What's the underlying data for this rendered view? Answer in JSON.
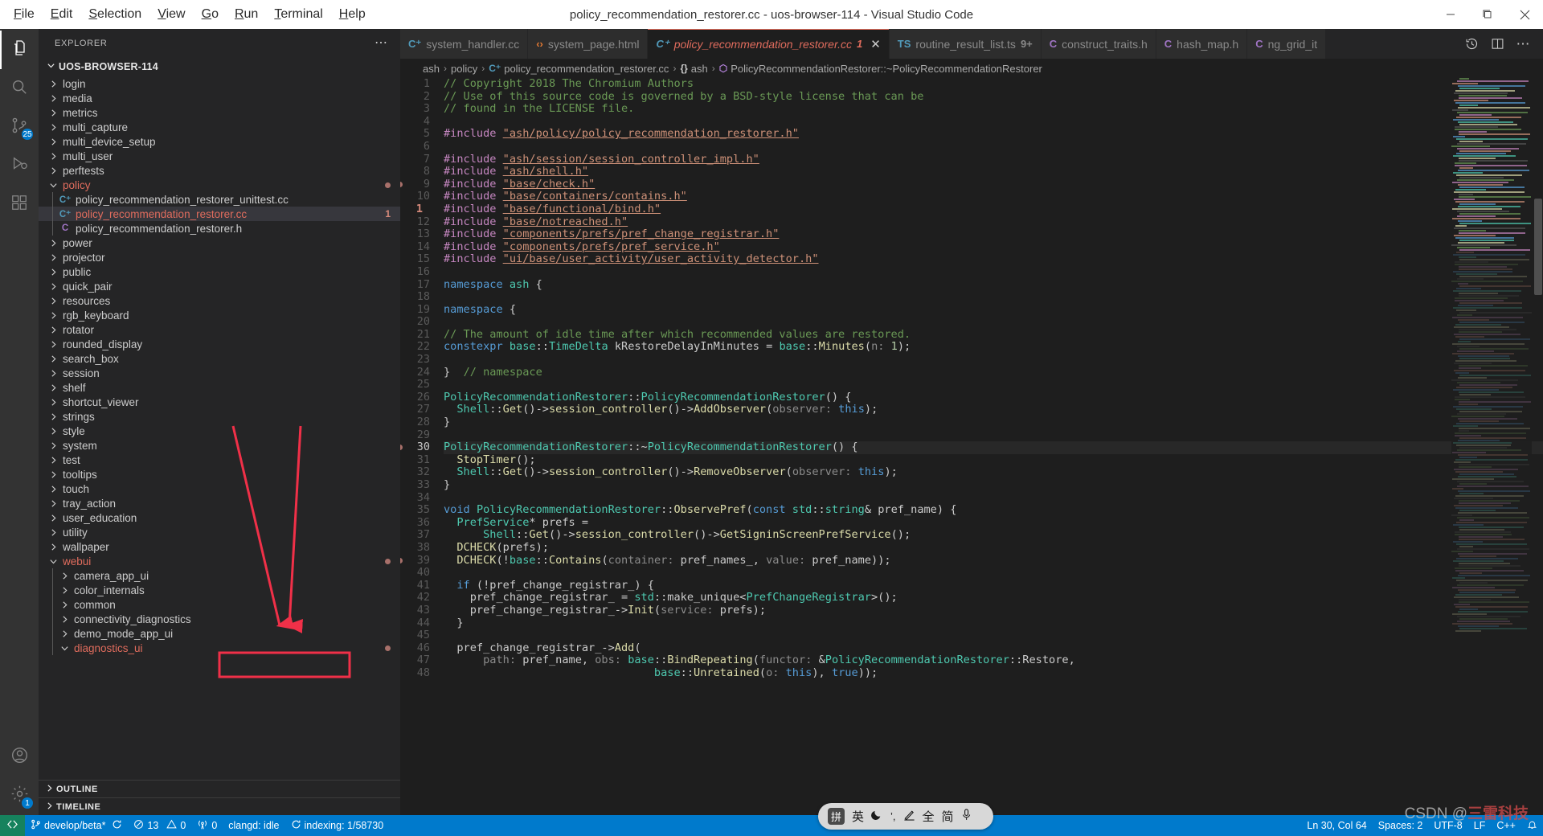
{
  "window": {
    "title": "policy_recommendation_restorer.cc - uos-browser-114 - Visual Studio Code",
    "minimize": "—",
    "maximize": "❐",
    "close": "✕"
  },
  "menu": [
    "File",
    "Edit",
    "Selection",
    "View",
    "Go",
    "Run",
    "Terminal",
    "Help"
  ],
  "activitybar": [
    {
      "name": "explorer",
      "icon": "files-icon",
      "glyph": "❐",
      "active": true,
      "badge": null
    },
    {
      "name": "search",
      "icon": "search-icon",
      "glyph": "⌕",
      "active": false,
      "badge": null
    },
    {
      "name": "source-control",
      "icon": "source-control-icon",
      "glyph": "⎇",
      "active": false,
      "badge": "25"
    },
    {
      "name": "run-debug",
      "icon": "run-debug-icon",
      "glyph": "▷",
      "active": false,
      "badge": null
    },
    {
      "name": "extensions",
      "icon": "extensions-icon",
      "glyph": "⊞",
      "active": false,
      "badge": null
    },
    {
      "name": "accounts",
      "icon": "account-icon",
      "glyph": "●",
      "active": false,
      "badge": null
    },
    {
      "name": "settings",
      "icon": "gear-icon",
      "glyph": "⚙",
      "active": false,
      "badge": "1"
    }
  ],
  "sidebar": {
    "title": "EXPLORER",
    "more": "⋯",
    "root": "UOS-BROWSER-114",
    "tree": [
      {
        "label": "login",
        "type": "folder",
        "expanded": false,
        "indent": 1,
        "partial": true
      },
      {
        "label": "media",
        "type": "folder",
        "expanded": false,
        "indent": 1
      },
      {
        "label": "metrics",
        "type": "folder",
        "expanded": false,
        "indent": 1
      },
      {
        "label": "multi_capture",
        "type": "folder",
        "expanded": false,
        "indent": 1
      },
      {
        "label": "multi_device_setup",
        "type": "folder",
        "expanded": false,
        "indent": 1
      },
      {
        "label": "multi_user",
        "type": "folder",
        "expanded": false,
        "indent": 1
      },
      {
        "label": "perftests",
        "type": "folder",
        "expanded": false,
        "indent": 1
      },
      {
        "label": "policy",
        "type": "folder",
        "expanded": true,
        "indent": 1,
        "modified": true,
        "dot": true
      },
      {
        "label": "policy_recommendation_restorer_unittest.cc",
        "type": "cpp",
        "indent": 2
      },
      {
        "label": "policy_recommendation_restorer.cc",
        "type": "cpp",
        "indent": 2,
        "selected": true,
        "modified": true,
        "count": "1"
      },
      {
        "label": "policy_recommendation_restorer.h",
        "type": "hdr",
        "indent": 2
      },
      {
        "label": "power",
        "type": "folder",
        "expanded": false,
        "indent": 1
      },
      {
        "label": "projector",
        "type": "folder",
        "expanded": false,
        "indent": 1
      },
      {
        "label": "public",
        "type": "folder",
        "expanded": false,
        "indent": 1
      },
      {
        "label": "quick_pair",
        "type": "folder",
        "expanded": false,
        "indent": 1
      },
      {
        "label": "resources",
        "type": "folder",
        "expanded": false,
        "indent": 1
      },
      {
        "label": "rgb_keyboard",
        "type": "folder",
        "expanded": false,
        "indent": 1
      },
      {
        "label": "rotator",
        "type": "folder",
        "expanded": false,
        "indent": 1
      },
      {
        "label": "rounded_display",
        "type": "folder",
        "expanded": false,
        "indent": 1
      },
      {
        "label": "search_box",
        "type": "folder",
        "expanded": false,
        "indent": 1
      },
      {
        "label": "session",
        "type": "folder",
        "expanded": false,
        "indent": 1
      },
      {
        "label": "shelf",
        "type": "folder",
        "expanded": false,
        "indent": 1
      },
      {
        "label": "shortcut_viewer",
        "type": "folder",
        "expanded": false,
        "indent": 1
      },
      {
        "label": "strings",
        "type": "folder",
        "expanded": false,
        "indent": 1
      },
      {
        "label": "style",
        "type": "folder",
        "expanded": false,
        "indent": 1
      },
      {
        "label": "system",
        "type": "folder",
        "expanded": false,
        "indent": 1
      },
      {
        "label": "test",
        "type": "folder",
        "expanded": false,
        "indent": 1
      },
      {
        "label": "tooltips",
        "type": "folder",
        "expanded": false,
        "indent": 1
      },
      {
        "label": "touch",
        "type": "folder",
        "expanded": false,
        "indent": 1
      },
      {
        "label": "tray_action",
        "type": "folder",
        "expanded": false,
        "indent": 1
      },
      {
        "label": "user_education",
        "type": "folder",
        "expanded": false,
        "indent": 1
      },
      {
        "label": "utility",
        "type": "folder",
        "expanded": false,
        "indent": 1
      },
      {
        "label": "wallpaper",
        "type": "folder",
        "expanded": false,
        "indent": 1
      },
      {
        "label": "webui",
        "type": "folder",
        "expanded": true,
        "indent": 1,
        "modified": true,
        "dot": true
      },
      {
        "label": "camera_app_ui",
        "type": "folder",
        "expanded": false,
        "indent": 2
      },
      {
        "label": "color_internals",
        "type": "folder",
        "expanded": false,
        "indent": 2
      },
      {
        "label": "common",
        "type": "folder",
        "expanded": false,
        "indent": 2
      },
      {
        "label": "connectivity_diagnostics",
        "type": "folder",
        "expanded": false,
        "indent": 2
      },
      {
        "label": "demo_mode_app_ui",
        "type": "folder",
        "expanded": false,
        "indent": 2
      },
      {
        "label": "diagnostics_ui",
        "type": "folder",
        "expanded": true,
        "indent": 2,
        "modified": true,
        "dot": true
      }
    ],
    "panels": [
      {
        "label": "OUTLINE",
        "expanded": false
      },
      {
        "label": "TIMELINE",
        "expanded": false
      }
    ]
  },
  "tabs": [
    {
      "label": "system_handler.cc",
      "icon": "cpp-file-icon",
      "icon_glyph": "C⁺",
      "icon_color": "#519aba",
      "active": false,
      "badge": null
    },
    {
      "label": "system_page.html",
      "icon": "html-file-icon",
      "icon_glyph": "‹›",
      "icon_color": "#e37933",
      "active": false,
      "badge": null
    },
    {
      "label": "policy_recommendation_restorer.cc",
      "icon": "cpp-file-icon",
      "icon_glyph": "C⁺",
      "icon_color": "#519aba",
      "active": true,
      "badge": "1",
      "closable": true,
      "close": "✕"
    },
    {
      "label": "routine_result_list.ts",
      "icon": "ts-file-icon",
      "icon_glyph": "TS",
      "icon_color": "#519aba",
      "active": false,
      "badge": "9+"
    },
    {
      "label": "construct_traits.h",
      "icon": "header-file-icon",
      "icon_glyph": "C",
      "icon_color": "#a074c4",
      "active": false,
      "badge": null
    },
    {
      "label": "hash_map.h",
      "icon": "header-file-icon",
      "icon_glyph": "C",
      "icon_color": "#a074c4",
      "active": false,
      "badge": null
    },
    {
      "label": "ng_grid_it",
      "icon": "header-file-icon",
      "icon_glyph": "C",
      "icon_color": "#a074c4",
      "active": false,
      "badge": null
    }
  ],
  "tab_actions": [
    {
      "name": "timeline-history-action",
      "glyph": "↺"
    },
    {
      "name": "split-editor-action",
      "glyph": "☐"
    },
    {
      "name": "more-actions",
      "glyph": "⋯"
    }
  ],
  "breadcrumb": [
    {
      "label": "ash",
      "icon": null
    },
    {
      "label": "policy",
      "icon": null
    },
    {
      "label": "policy_recommendation_restorer.cc",
      "icon": "cpp-file-icon",
      "icon_glyph": "C⁺",
      "icon_color": "#519aba"
    },
    {
      "label": "ash",
      "icon": "namespace-icon",
      "icon_glyph": "{}",
      "icon_color": "#cccccc"
    },
    {
      "label": "PolicyRecommendationRestorer::~PolicyRecommendationRestorer",
      "icon": "method-icon",
      "icon_glyph": "⬡",
      "icon_color": "#b180d7"
    }
  ],
  "editor": {
    "first_line": 1,
    "current_line": 30,
    "lines": [
      {
        "n": 1,
        "t": "// Copyright 2018 The Chromium Authors"
      },
      {
        "n": 2,
        "t": "// Use of this source code is governed by a BSD-style license that can be"
      },
      {
        "n": 3,
        "t": "// found in the LICENSE file."
      },
      {
        "n": 4,
        "t": ""
      },
      {
        "n": 5,
        "t": "#include \"ash/policy/policy_recommendation_restorer.h\""
      },
      {
        "n": 6,
        "t": ""
      },
      {
        "n": 7,
        "t": "#include \"ash/session/session_controller_impl.h\""
      },
      {
        "n": 8,
        "t": "#include \"ash/shell.h\""
      },
      {
        "n": 9,
        "t": "#include \"base/check.h\""
      },
      {
        "n": 10,
        "t": "#include \"base/containers/contains.h\""
      },
      {
        "n": 11,
        "t": "#include \"base/functional/bind.h\""
      },
      {
        "n": 12,
        "t": "#include \"base/notreached.h\""
      },
      {
        "n": 13,
        "t": "#include \"components/prefs/pref_change_registrar.h\""
      },
      {
        "n": 14,
        "t": "#include \"components/prefs/pref_service.h\""
      },
      {
        "n": 15,
        "t": "#include \"ui/base/user_activity/user_activity_detector.h\""
      },
      {
        "n": 16,
        "t": ""
      },
      {
        "n": 17,
        "t": "namespace ash {"
      },
      {
        "n": 18,
        "t": ""
      },
      {
        "n": 19,
        "t": "namespace {"
      },
      {
        "n": 20,
        "t": ""
      },
      {
        "n": 21,
        "t": "// The amount of idle time after which recommended values are restored."
      },
      {
        "n": 22,
        "t": "constexpr base::TimeDelta kRestoreDelayInMinutes = base::Minutes(n: 1);"
      },
      {
        "n": 23,
        "t": ""
      },
      {
        "n": 24,
        "t": "}  // namespace"
      },
      {
        "n": 25,
        "t": ""
      },
      {
        "n": 26,
        "t": "PolicyRecommendationRestorer::PolicyRecommendationRestorer() {"
      },
      {
        "n": 27,
        "t": "  Shell::Get()->session_controller()->AddObserver(observer: this);"
      },
      {
        "n": 28,
        "t": "}"
      },
      {
        "n": 29,
        "t": ""
      },
      {
        "n": 30,
        "t": "PolicyRecommendationRestorer::~PolicyRecommendationRestorer() {"
      },
      {
        "n": 31,
        "t": "  StopTimer();"
      },
      {
        "n": 32,
        "t": "  Shell::Get()->session_controller()->RemoveObserver(observer: this);"
      },
      {
        "n": 33,
        "t": "}"
      },
      {
        "n": 34,
        "t": ""
      },
      {
        "n": 35,
        "t": "void PolicyRecommendationRestorer::ObservePref(const std::string& pref_name) {"
      },
      {
        "n": 36,
        "t": "  PrefService* prefs ="
      },
      {
        "n": 37,
        "t": "      Shell::Get()->session_controller()->GetSigninScreenPrefService();"
      },
      {
        "n": 38,
        "t": "  DCHECK(prefs);"
      },
      {
        "n": 39,
        "t": "  DCHECK(!base::Contains(container: pref_names_, value: pref_name));"
      },
      {
        "n": 40,
        "t": ""
      },
      {
        "n": 41,
        "t": "  if (!pref_change_registrar_) {"
      },
      {
        "n": 42,
        "t": "    pref_change_registrar_ = std::make_unique<PrefChangeRegistrar>();"
      },
      {
        "n": 43,
        "t": "    pref_change_registrar_->Init(service: prefs);"
      },
      {
        "n": 44,
        "t": "  }"
      },
      {
        "n": 45,
        "t": ""
      },
      {
        "n": 46,
        "t": "  pref_change_registrar_->Add("
      },
      {
        "n": 47,
        "t": "      path: pref_name, obs: base::BindRepeating(functor: &PolicyRecommendationRestorer::Restore,"
      },
      {
        "n": 48,
        "t": "                                base::Unretained(o: this), true));"
      }
    ],
    "gutter_marks": [
      {
        "line": 9,
        "type": "dot"
      },
      {
        "line": 30,
        "type": "dot"
      },
      {
        "line": 39,
        "type": "dot"
      },
      {
        "line": 11,
        "type": "count",
        "text": "1"
      }
    ]
  },
  "statusbar": {
    "remote_icon": "remote-window-icon",
    "remote_glyph": "≶",
    "left": [
      {
        "name": "branch",
        "icon": "source-control-icon",
        "glyph": "⎇",
        "text": "develop/beta*"
      },
      {
        "name": "sync",
        "icon": "sync-icon",
        "glyph": "↻",
        "text": ""
      },
      {
        "name": "problems-errors",
        "icon": "error-icon",
        "glyph": "⊗",
        "text": "13"
      },
      {
        "name": "problems-warnings",
        "icon": "warning-icon",
        "glyph": "⚠",
        "text": "0"
      },
      {
        "name": "ports",
        "icon": "radio-tower-icon",
        "glyph": "Ⓦ",
        "text": "0"
      },
      {
        "name": "clangd-status",
        "icon": null,
        "glyph": "",
        "text": "clangd: idle"
      },
      {
        "name": "indexing-status",
        "icon": "loading-icon",
        "glyph": "↻",
        "text": "indexing: 1/58730"
      }
    ],
    "right": [
      {
        "name": "editor-position",
        "text": "Ln 30, Col 64"
      },
      {
        "name": "editor-indentation",
        "text": "Spaces: 2"
      },
      {
        "name": "editor-encoding",
        "text": "UTF-8"
      },
      {
        "name": "editor-eol",
        "text": "LF"
      },
      {
        "name": "editor-language",
        "text": "C++"
      },
      {
        "name": "notifications",
        "text": "⚙"
      }
    ]
  },
  "ime_bar": {
    "items": [
      {
        "name": "ime-pinyin-toggle",
        "glyph": "拼"
      },
      {
        "name": "ime-english-toggle",
        "glyph": "英"
      },
      {
        "name": "ime-moon-mode",
        "glyph": "☽"
      },
      {
        "name": "ime-punctuation",
        "glyph": "’,"
      },
      {
        "name": "ime-handwriting",
        "glyph": "✎"
      },
      {
        "name": "ime-fullwidth",
        "glyph": "全"
      },
      {
        "name": "ime-simplified",
        "glyph": "简"
      },
      {
        "name": "ime-voice-input",
        "glyph": "Ἲ4"
      }
    ]
  },
  "annotations": {
    "highlight_box_label": "indexing: 1/58730",
    "arrow_color": "#f03048",
    "box_color": "#f03048"
  },
  "watermark": {
    "prefix": "CSDN @",
    "cn": "三雷科技"
  },
  "colors": {
    "accent": "#007acc",
    "remote_green": "#16825d",
    "active_tab_fg": "#e06c5d",
    "sidebar_bg": "#252526",
    "editor_bg": "#1e1e1e",
    "activitybar_bg": "#333333"
  }
}
